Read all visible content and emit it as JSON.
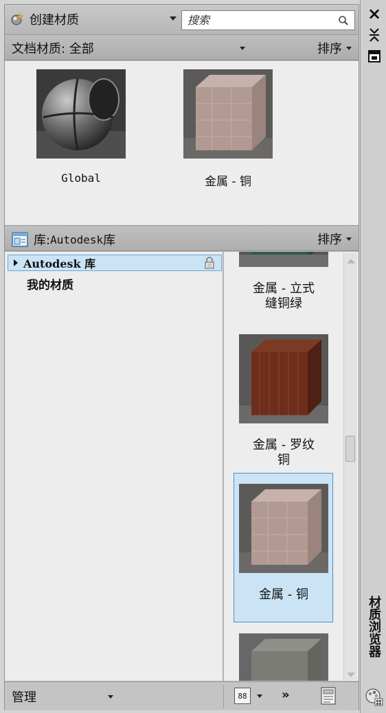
{
  "toolbar": {
    "create_label": "创建材质",
    "search_placeholder": "搜索"
  },
  "document": {
    "filter_label": "文档材质: 全部",
    "sort_label": "排序",
    "materials": [
      {
        "name": "Global"
      },
      {
        "name": "金属 - 铜"
      }
    ]
  },
  "library": {
    "title_prefix": "库: ",
    "title_name": "Autodesk",
    "title_suffix": " 库",
    "sort_label": "排序",
    "tree": [
      {
        "label": "Autodesk 库",
        "selected": true,
        "locked": true
      },
      {
        "label": "我的材质",
        "selected": false
      }
    ],
    "materials": [
      {
        "name": "金属 - 立式\n缝铜绿"
      },
      {
        "name": "金属 - 罗纹\n铜"
      },
      {
        "name": "金属 - 铜",
        "selected": true
      },
      {
        "name": ""
      }
    ]
  },
  "bottom": {
    "manage_label": "管理",
    "view_label": "88",
    "more_label": "»"
  },
  "strip": {
    "title": "材质浏览器"
  },
  "colors": {
    "selection_bg": "#cbe4f5",
    "selection_border": "#4e8cc9"
  }
}
